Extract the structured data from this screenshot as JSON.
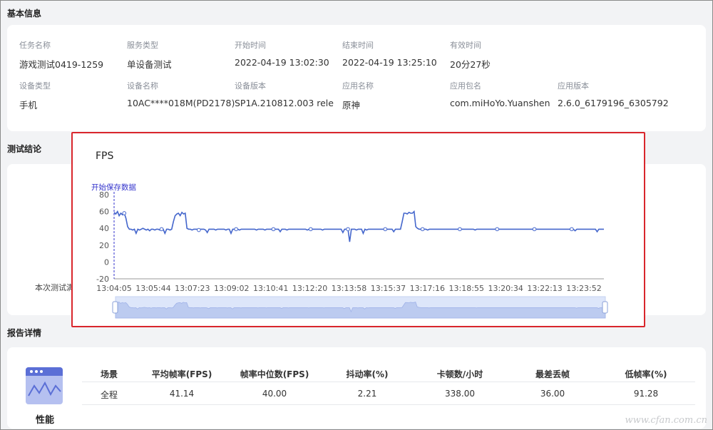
{
  "basic_info": {
    "title": "基本信息",
    "fields": [
      {
        "label": "任务名称",
        "value": "游戏测试0419-1259"
      },
      {
        "label": "服务类型",
        "value": "单设备测试"
      },
      {
        "label": "开始时间",
        "value": "2022-04-19 13:02:30"
      },
      {
        "label": "结束时间",
        "value": "2022-04-19 13:25:10"
      },
      {
        "label": "有效时间",
        "value": "20分27秒"
      },
      {
        "label": "设备类型",
        "value": "手机"
      },
      {
        "label": "设备名称",
        "value": "10AC****018M(PD2178)"
      },
      {
        "label": "设备版本",
        "value": "SP1A.210812.003 rele..."
      },
      {
        "label": "应用名称",
        "value": "原神"
      },
      {
        "label": "应用包名",
        "value": "com.miHoYo.Yuanshen"
      },
      {
        "label": "应用版本",
        "value": "2.6.0_6179196_6305792"
      }
    ]
  },
  "conclusion": {
    "title": "测试结论",
    "text_fragment": "本次测试满"
  },
  "report": {
    "title": "报告详情",
    "category": "性能",
    "headers": [
      "场景",
      "平均帧率(FPS)",
      "帧率中位数(FPS)",
      "抖动率(%)",
      "卡顿数/小时",
      "最差丢帧",
      "低帧率(%)"
    ],
    "rows": [
      [
        "全程",
        "41.14",
        "40.00",
        "2.21",
        "338.00",
        "36.00",
        "91.28"
      ]
    ]
  },
  "watermark": "www.cfan.com.cn",
  "colors": {
    "line": "#4466cc",
    "accent_red": "#d9262c",
    "marker": "#3333cc"
  },
  "chart_data": {
    "type": "line",
    "title": "FPS",
    "marker_label": "开始保存数据",
    "ylim": [
      -20,
      80
    ],
    "yticks": [
      -20,
      0,
      20,
      40,
      60,
      80
    ],
    "xtick_labels": [
      "13:04:05",
      "13:05:44",
      "13:07:23",
      "13:09:02",
      "13:10:41",
      "13:12:20",
      "13:13:58",
      "13:15:37",
      "13:17:16",
      "13:18:55",
      "13:20:34",
      "13:22:13",
      "13:23:52"
    ],
    "series": [
      {
        "values": [
          59,
          57,
          60,
          55,
          58,
          56,
          58,
          52,
          42,
          39,
          39,
          38,
          39,
          34,
          39,
          38,
          39,
          40,
          39,
          38,
          39,
          37,
          39,
          39,
          38,
          39,
          39,
          38,
          39,
          39,
          34,
          39,
          39,
          38,
          39,
          48,
          55,
          57,
          58,
          55,
          59,
          57,
          58,
          40,
          39,
          39,
          38,
          39,
          39,
          39,
          38,
          39,
          39,
          39,
          38,
          35,
          39,
          39,
          39,
          39,
          38,
          39,
          39,
          39,
          39,
          39,
          38,
          39,
          39,
          34,
          39,
          39,
          39,
          39,
          38,
          39,
          39,
          39,
          39,
          39,
          39,
          39,
          39,
          39,
          38,
          39,
          39,
          39,
          39,
          38,
          39,
          39,
          39,
          39,
          39,
          39,
          39,
          39,
          36,
          39,
          39,
          39,
          38,
          39,
          39,
          39,
          39,
          39,
          39,
          39,
          39,
          39,
          39,
          39,
          38,
          39,
          39,
          39,
          39,
          39,
          39,
          39,
          39,
          38,
          39,
          39,
          39,
          39,
          39,
          39,
          39,
          39,
          39,
          39,
          39,
          35,
          39,
          39,
          39,
          24,
          39,
          39,
          39,
          38,
          39,
          39,
          39,
          34,
          39,
          38,
          39,
          39,
          39,
          39,
          39,
          39,
          39,
          39,
          39,
          39,
          39,
          39,
          39,
          39,
          39,
          36,
          39,
          39,
          39,
          39,
          48,
          58,
          58,
          57,
          59,
          58,
          58,
          60,
          42,
          40,
          39,
          39,
          39,
          39,
          39,
          38,
          39,
          39,
          39,
          39,
          39,
          39,
          39,
          39,
          39,
          39,
          39,
          39,
          39,
          39,
          39,
          39,
          39,
          39,
          39,
          39,
          39,
          39,
          39,
          39,
          39,
          39,
          39,
          38,
          39,
          39,
          39,
          39,
          39,
          39,
          39,
          39,
          39,
          39,
          39,
          39,
          39,
          39,
          39,
          39,
          39,
          39,
          39,
          39,
          39,
          39,
          39,
          39,
          39,
          39,
          39,
          39,
          39,
          39,
          39,
          39,
          39,
          39,
          39,
          39,
          39,
          39,
          39,
          39,
          39,
          39,
          39,
          39,
          39,
          39,
          39,
          39,
          39,
          39,
          39,
          39,
          39,
          39,
          39,
          39,
          39,
          39,
          37,
          39,
          39,
          39,
          39,
          39,
          39,
          39,
          39,
          39,
          39,
          39,
          39,
          36,
          39,
          39,
          39,
          39
        ]
      }
    ],
    "grid": false
  }
}
